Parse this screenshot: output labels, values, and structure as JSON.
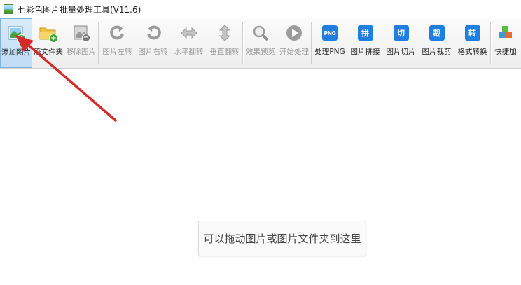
{
  "window": {
    "title": "七彩色图片批量处理工具(V11.6)"
  },
  "toolbar": {
    "add_image": "添加图片",
    "add_folder": "添文件夹",
    "remove_image": "移除图片",
    "rotate_left": "图片左转",
    "rotate_right": "图片右转",
    "flip_horizontal": "水平翻转",
    "flip_vertical": "垂直翻转",
    "preview": "效果预览",
    "start": "开始处理",
    "process_png": "处理PNG",
    "png_badge": "PNG",
    "stitch": "图片拼接",
    "stitch_badge": "拼",
    "slice": "图片切片",
    "slice_badge": "切",
    "crop": "图片裁剪",
    "crop_badge": "裁",
    "convert": "格式转换",
    "convert_badge": "转",
    "quick": "快捷加"
  },
  "main": {
    "drop_hint": "可以拖动图片或图片文件夹到这里"
  },
  "colors": {
    "accent_blue": "#1f7fe0",
    "arrow_red": "#d42a2a",
    "add_green": "#3aa83a"
  }
}
